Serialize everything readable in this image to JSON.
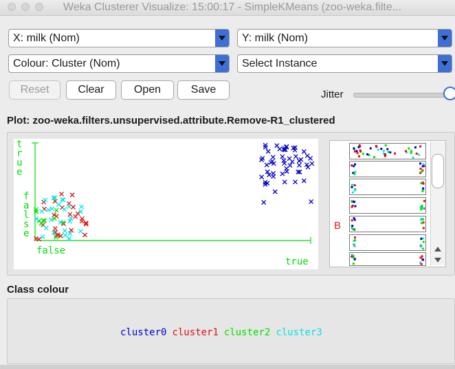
{
  "window": {
    "title": "Weka Clusterer Visualize: 15:00:17 - SimpleKMeans (zoo-weka.filte..."
  },
  "controls": {
    "x_axis_select": "X: milk (Nom)",
    "y_axis_select": "Y: milk (Nom)",
    "colour_select": "Colour: Cluster (Nom)",
    "instance_select": "Select Instance",
    "reset_label": "Reset",
    "clear_label": "Clear",
    "open_label": "Open",
    "save_label": "Save",
    "jitter_label": "Jitter",
    "jitter_value": 1.0
  },
  "plot": {
    "title": "Plot: zoo-weka.filters.unsupervised.attribute.Remove-R1_clustered",
    "y_tick_top": "true",
    "y_tick_bottom": "false",
    "x_tick_left": "false",
    "x_tick_right": "true",
    "axis_color": "#00e000"
  },
  "attribute_panel": {
    "selected_letter": "B"
  },
  "class_colour": {
    "title": "Class colour",
    "clusters": [
      {
        "label": "cluster0",
        "color": "#0000cc"
      },
      {
        "label": "cluster1",
        "color": "#e01010"
      },
      {
        "label": "cluster2",
        "color": "#00e000"
      },
      {
        "label": "cluster3",
        "color": "#00e6e6"
      }
    ]
  }
}
